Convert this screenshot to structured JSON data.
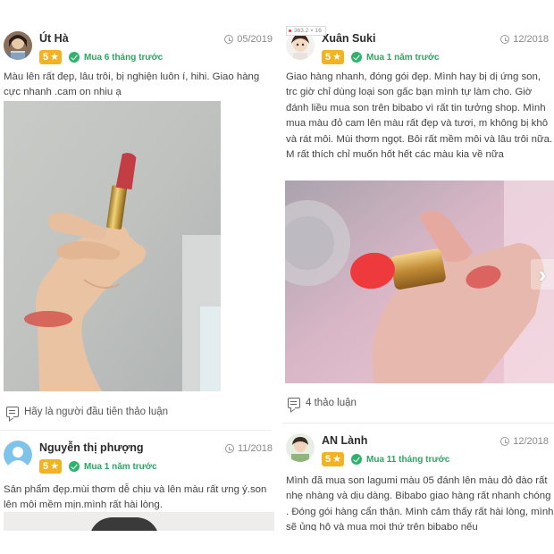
{
  "tooltip": "363.2 × 16",
  "reviews": [
    {
      "name": "Út Hà",
      "date": "05/2019",
      "rating": "5",
      "purchase": "Mua 6 tháng trước",
      "text": "Màu lên rất đẹp, lâu trôi, bị nghiện luôn í, hihi. Giao hàng cực nhanh .cam on nhiu ạ",
      "discussion": "Hãy là người đầu tiên thảo luận"
    },
    {
      "name": "Xuân Suki",
      "date": "12/2018",
      "rating": "5",
      "purchase": "Mua 1 năm trước",
      "text": "Giao hàng nhanh, đóng gói đẹp. Mình hay bị dị ứng son, trc giờ chỉ dùng loại son gấc bạn mình tự làm cho. Giờ đánh liều mua son trên bibabo vì rất tin tưởng shop. Mình mua màu đỏ cam lên màu rất đẹp và tươi, m không bị khô và rát môi. Mùi thơm ngọt. Bôi rất mềm môi và lâu trôi nữa. M rất thích chỉ muốn hốt hết các màu kia về nữa",
      "discussion": "4 thảo luận"
    },
    {
      "name": "Nguyễn thị phượng",
      "date": "11/2018",
      "rating": "5",
      "purchase": "Mua 1 năm trước",
      "text": "Sản phẩm đẹp.mùi thơm dễ chịu và lên màu rất ưng ý.son lên môi mềm mịn.mình rất hài lòng."
    },
    {
      "name": "AN Lành",
      "date": "12/2018",
      "rating": "5",
      "purchase": "Mua 11 tháng trước",
      "text": "Mình đã mua son lagumi màu 05 đánh lên màu đỏ đào rất nhẹ nhàng và dịu dàng. Bibabo giao hàng rất nhanh chóng . Đóng gói hàng cẩn thận. Mình cảm thấy rất hài lòng, mình sẽ ủng hộ và mua mọi thứ trên bibabo nếu"
    }
  ],
  "icons": {
    "clock": "clock-icon",
    "star": "star-icon",
    "verified": "check-icon",
    "chat": "chat-icon",
    "next": "chevron-right-icon"
  },
  "colors": {
    "badge": "#f2b322",
    "verified_green": "#2aa861",
    "lipstick_red": "#c8323a",
    "lipstick_coral": "#ee3a3c"
  }
}
